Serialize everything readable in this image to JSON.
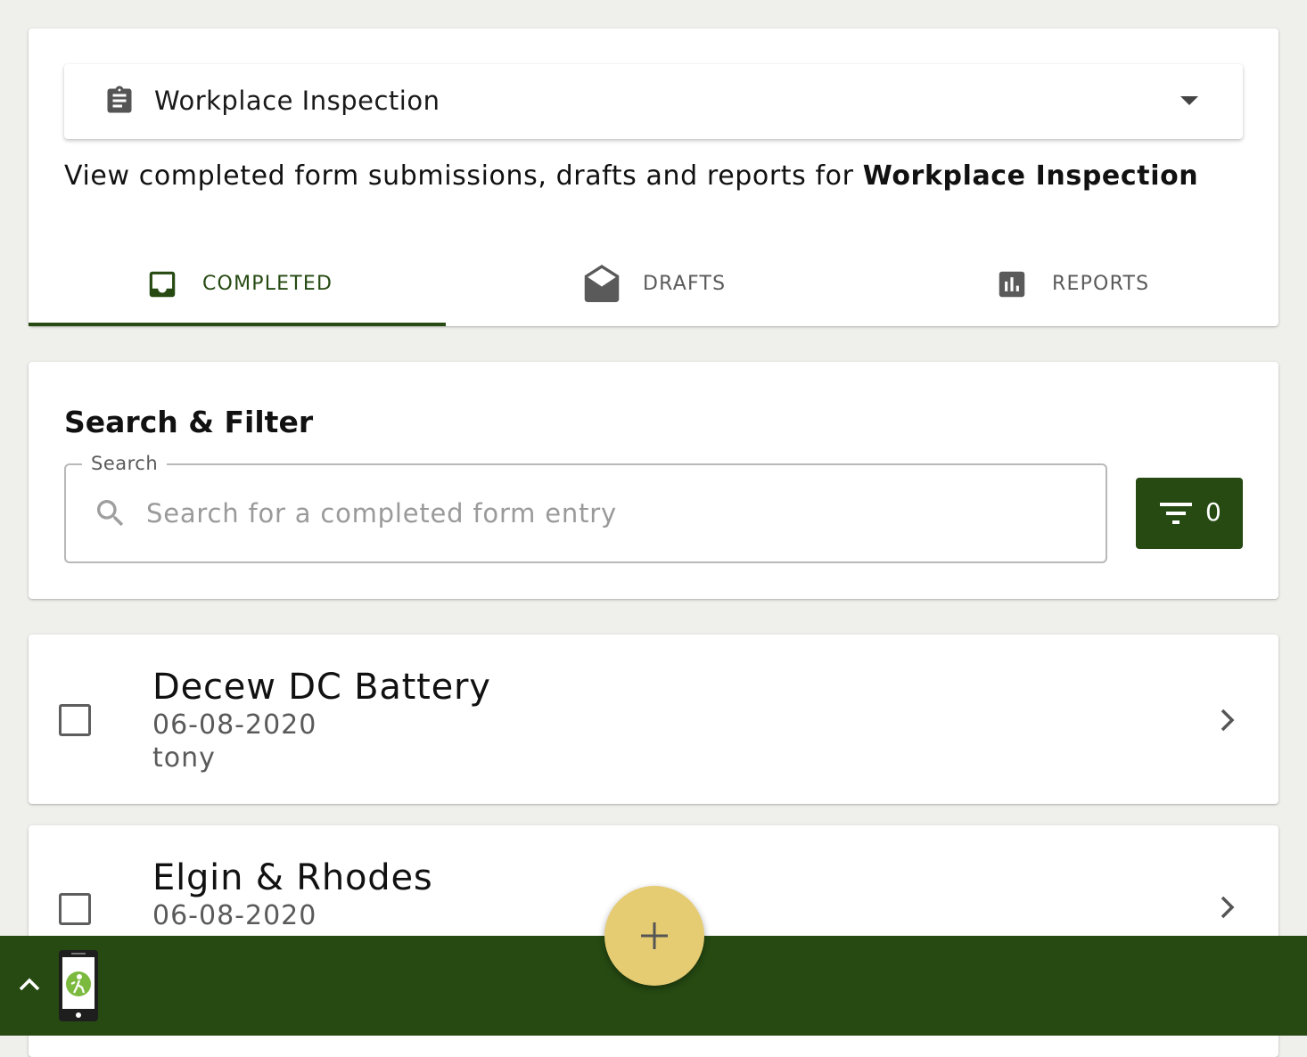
{
  "form_select": {
    "label": "Workplace Inspection",
    "icon": "clipboard-icon"
  },
  "description": {
    "prefix": "View completed form submissions, drafts and reports for ",
    "form_name": "Workplace Inspection"
  },
  "tabs": [
    {
      "label": "COMPLETED",
      "icon": "inbox-icon",
      "active": true
    },
    {
      "label": "DRAFTS",
      "icon": "open-envelope-icon",
      "active": false
    },
    {
      "label": "REPORTS",
      "icon": "bar-chart-icon",
      "active": false
    }
  ],
  "search_filter": {
    "title": "Search & Filter",
    "search_label": "Search",
    "search_placeholder": "Search for a completed form entry",
    "search_value": "",
    "filter_count": "0"
  },
  "entries": [
    {
      "title": "Decew DC Battery",
      "date": "06-08-2020",
      "user": "tony"
    },
    {
      "title": "Elgin & Rhodes",
      "date": "06-08-2020",
      "user": ""
    }
  ],
  "colors": {
    "primary": "#264a12",
    "fab": "#e5cc73",
    "background": "#efefeb"
  }
}
